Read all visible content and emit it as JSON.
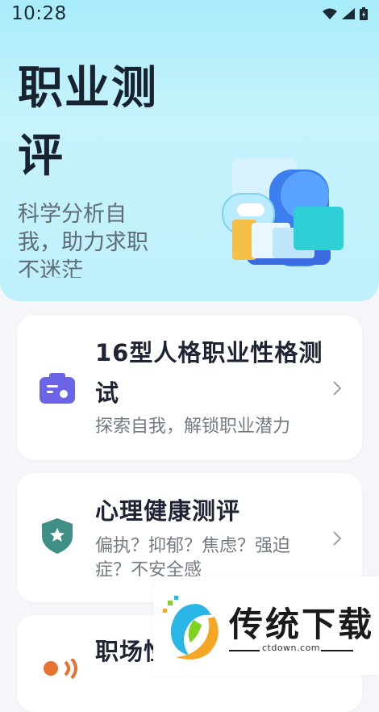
{
  "status_bar": {
    "time": "10:28"
  },
  "hero": {
    "title": "职业测评",
    "subtitle": "科学分析自我，助力求职不迷茫"
  },
  "cards": [
    {
      "title": "16型人格职业性格测试",
      "description": "探索自我，解锁职业潜力",
      "icon": "briefcase-icon"
    },
    {
      "title": "心理健康测评",
      "description": "偏执？抑郁？焦虑？强迫症？不安全感",
      "icon": "shield-star-icon"
    },
    {
      "title": "职场性",
      "description": "",
      "icon": "person-signal-icon"
    }
  ],
  "watermark": {
    "text": "传统下载",
    "domain": "ctdown.com"
  },
  "colors": {
    "hero_top": "#a9ecfa",
    "card_icon_purple": "#6c63e6",
    "card_icon_teal": "#3f8f86",
    "card_icon_orange": "#e8712e"
  }
}
